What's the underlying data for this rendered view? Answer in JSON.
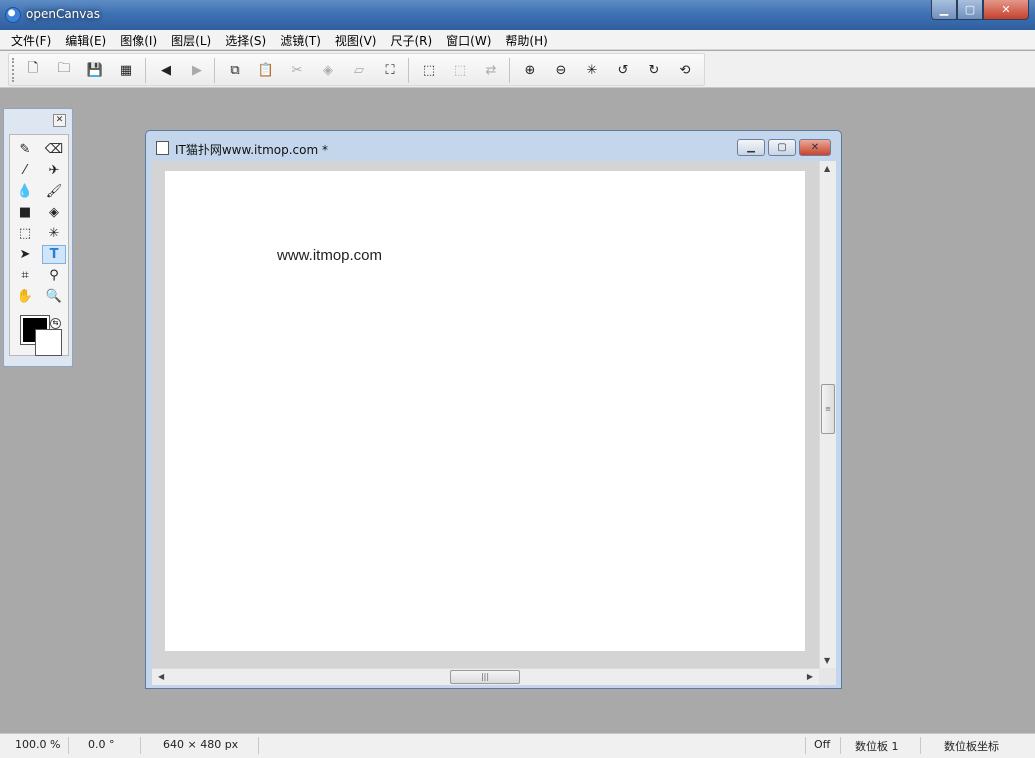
{
  "app": {
    "title": "openCanvas",
    "icon": "opencanvas-logo-icon"
  },
  "window_buttons": {
    "minimize": "minimize-icon",
    "maximize": "maximize-icon",
    "close": "close-icon"
  },
  "menu": [
    "文件(F)",
    "编辑(E)",
    "图像(I)",
    "图层(L)",
    "选择(S)",
    "滤镜(T)",
    "视图(V)",
    "尺子(R)",
    "窗口(W)",
    "帮助(H)"
  ],
  "toolbar": [
    {
      "name": "new-file-icon",
      "glyph": "🗋"
    },
    {
      "name": "open-folder-icon",
      "glyph": "🗀"
    },
    {
      "name": "save-icon",
      "glyph": "💾"
    },
    {
      "name": "save-all-icon",
      "glyph": "▦"
    },
    {
      "name": "prev-icon",
      "glyph": "◀"
    },
    {
      "name": "next-icon",
      "glyph": "▶",
      "disabled": true
    },
    {
      "name": "copy-icon",
      "glyph": "⧉"
    },
    {
      "name": "paste-icon",
      "glyph": "📋",
      "disabled": true
    },
    {
      "name": "cut-icon",
      "glyph": "✂",
      "disabled": true
    },
    {
      "name": "fill-icon",
      "glyph": "◈",
      "disabled": true
    },
    {
      "name": "eraser-icon",
      "glyph": "▱",
      "disabled": true
    },
    {
      "name": "transform-icon",
      "glyph": "⛶"
    },
    {
      "name": "select-rect-icon",
      "glyph": "⬚"
    },
    {
      "name": "deselect-icon",
      "glyph": "⬚",
      "disabled": true
    },
    {
      "name": "invert-selection-icon",
      "glyph": "⇄",
      "disabled": true
    },
    {
      "name": "zoom-in-icon",
      "glyph": "⊕"
    },
    {
      "name": "zoom-out-icon",
      "glyph": "⊖"
    },
    {
      "name": "zoom-fit-icon",
      "glyph": "✳"
    },
    {
      "name": "rotate-left-icon",
      "glyph": "↺"
    },
    {
      "name": "rotate-right-icon",
      "glyph": "↻"
    },
    {
      "name": "rotate-reset-icon",
      "glyph": "⟲"
    }
  ],
  "palette": {
    "tools": [
      {
        "name": "pen-icon",
        "glyph": "✎"
      },
      {
        "name": "eraser-tool-icon",
        "glyph": "⌫"
      },
      {
        "name": "brush-icon",
        "glyph": "⁄"
      },
      {
        "name": "airbrush-icon",
        "glyph": "✈"
      },
      {
        "name": "watercolor-icon",
        "glyph": "💧"
      },
      {
        "name": "marker-icon",
        "glyph": "🖌"
      },
      {
        "name": "gradient-icon",
        "glyph": "■"
      },
      {
        "name": "paint-bucket-icon",
        "glyph": "◈"
      },
      {
        "name": "selection-tool-icon",
        "glyph": "⬚"
      },
      {
        "name": "magic-wand-icon",
        "glyph": "✳"
      },
      {
        "name": "move-icon",
        "glyph": "➤"
      },
      {
        "name": "text-tool-icon",
        "glyph": "T",
        "active": true
      },
      {
        "name": "crop-icon",
        "glyph": "⌗"
      },
      {
        "name": "eyedropper-icon",
        "glyph": "⚲"
      },
      {
        "name": "hand-icon",
        "glyph": "✋"
      },
      {
        "name": "magnifier-icon",
        "glyph": "🔍"
      }
    ],
    "foreground_color": "#000000",
    "background_color": "#ffffff"
  },
  "document": {
    "title": "IT猫扑网www.itmop.com *",
    "canvas_text": "www.itmop.com",
    "canvas_width": 640,
    "canvas_height": 480
  },
  "status": {
    "zoom": "100.0 %",
    "angle": "0.0 °",
    "size": "640 × 480 px",
    "state": "Off",
    "tablet": "数位板 1",
    "tablet_coords": "数位板坐标"
  }
}
